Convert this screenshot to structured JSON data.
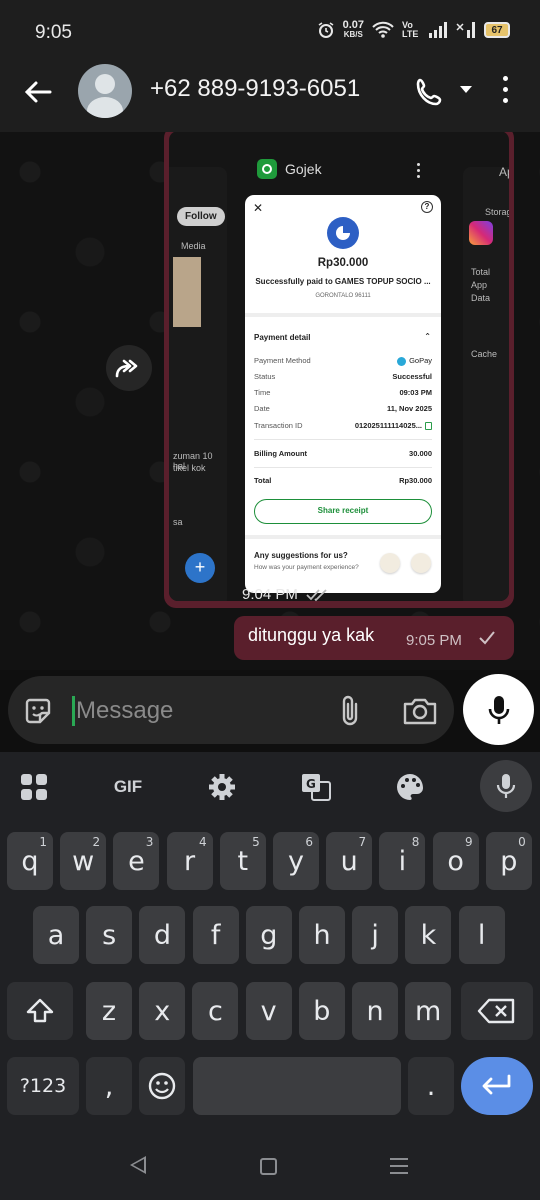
{
  "status_bar": {
    "time": "9:05",
    "net_speed": "0.07",
    "net_unit": "KB/S",
    "volte": "Vo LTE",
    "battery": "67"
  },
  "header": {
    "contact": "+62 889-9193-6051"
  },
  "image_message": {
    "screenshot": {
      "app_name": "Gojek",
      "left_follow": "Follow",
      "left_media": "Media",
      "left_text1": "zuman 10 hal",
      "left_text2": "tikel kok",
      "left_text3": "sa",
      "right_app": "Ap",
      "right_storage": "Storag",
      "right_total": "Total",
      "right_app2": "App",
      "right_data": "Data",
      "right_cache": "Cache",
      "receipt": {
        "amount": "Rp30.000",
        "paid_to": "Successfully paid to GAMES TOPUP SOCIO ...",
        "location": "GORONTALO 96111",
        "payment_detail": "Payment detail",
        "rows": [
          {
            "key": "Payment Method",
            "value": "GoPay"
          },
          {
            "key": "Status",
            "value": "Successful"
          },
          {
            "key": "Time",
            "value": "09:03 PM"
          },
          {
            "key": "Date",
            "value": "11, Nov 2025"
          },
          {
            "key": "Transaction ID",
            "value": "012025111114025..."
          }
        ],
        "billing_label": "Billing Amount",
        "billing_value": "30.000",
        "total_label": "Total",
        "total_value": "Rp30.000",
        "share_label": "Share receipt",
        "suggest_title": "Any suggestions for us?",
        "suggest_sub": "How was your payment experience?"
      }
    },
    "time": "9:04 PM"
  },
  "text_message": {
    "text": "ditunggu ya kak",
    "time": "9:05 PM"
  },
  "composer": {
    "placeholder": "Message"
  },
  "keyboard": {
    "toolbar": {
      "gif": "GIF"
    },
    "row1": [
      {
        "k": "q",
        "n": "1"
      },
      {
        "k": "w",
        "n": "2"
      },
      {
        "k": "e",
        "n": "3"
      },
      {
        "k": "r",
        "n": "4"
      },
      {
        "k": "t",
        "n": "5"
      },
      {
        "k": "y",
        "n": "6"
      },
      {
        "k": "u",
        "n": "7"
      },
      {
        "k": "i",
        "n": "8"
      },
      {
        "k": "o",
        "n": "9"
      },
      {
        "k": "p",
        "n": "0"
      }
    ],
    "row2": [
      "a",
      "s",
      "d",
      "f",
      "g",
      "h",
      "j",
      "k",
      "l"
    ],
    "row3": [
      "z",
      "x",
      "c",
      "v",
      "b",
      "n",
      "m"
    ],
    "symbols": "?123",
    "comma": ",",
    "period": "."
  },
  "colors": {
    "bubble": "#5a1f2c",
    "accent_green": "#2aa854",
    "enter_key": "#5b8ee6"
  }
}
